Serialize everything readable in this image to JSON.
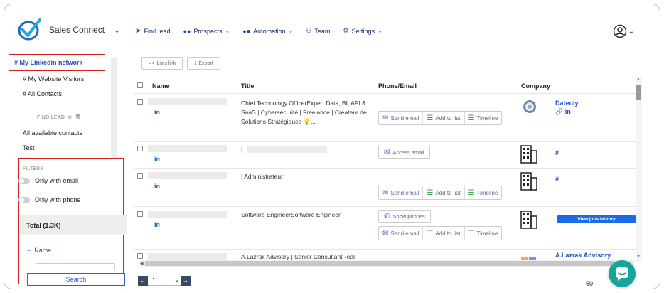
{
  "app": {
    "name": "Sales Connect"
  },
  "nav": [
    {
      "label": "Find lead",
      "icon": "send-icon"
    },
    {
      "label": "Prospects",
      "icon": "users-icon"
    },
    {
      "label": "Automation",
      "icon": "automation-icon"
    },
    {
      "label": "Team",
      "icon": "team-icon"
    },
    {
      "label": "Settings",
      "icon": "gear-icon"
    }
  ],
  "sidebar": {
    "lists": [
      "# My Linkedin network",
      "# My Website Visitors",
      "# All Contacts"
    ],
    "find_lead_label": "FIND LEAD",
    "sources": [
      "All available contacts",
      "Test"
    ],
    "filters_label": "FILTERS",
    "filter_email": "Only with email",
    "filter_phone": "Only with phone",
    "total": "Total (1.3K)",
    "name_section": "Name",
    "name_collapse": "−",
    "search": "Search"
  },
  "toolbar": {
    "lists_link": "Lists link",
    "export": "Export"
  },
  "table": {
    "columns": [
      "Name",
      "Title",
      "Phone/Email",
      "Company"
    ],
    "linkedin_label": "in",
    "actions": {
      "send_email": "Send email",
      "add_to_list": "Add to list",
      "timeline": "Timeline",
      "access_email": "Access email",
      "show_phones": "Show phones",
      "view_jobs": "View jobs history"
    },
    "rows": [
      {
        "title": "Chief Technology OfficerExpert Data, BI, API & SaaS | Cybersécurité | Freelance | Créateur de Solutions Stratégiques 💡...",
        "company": "Datenly",
        "company_link": "🔗 in"
      },
      {
        "title": "|",
        "company": "#"
      },
      {
        "title": "| Administrateur",
        "company": "#"
      },
      {
        "title": "Software EngineerSoftware Engineer",
        "company": ""
      },
      {
        "title": "A.Lazrak Advisory | Senior ConsultantReal",
        "company": "A.Lazrak Advisory"
      }
    ]
  },
  "pager": {
    "page": "1",
    "per_page": "50"
  }
}
